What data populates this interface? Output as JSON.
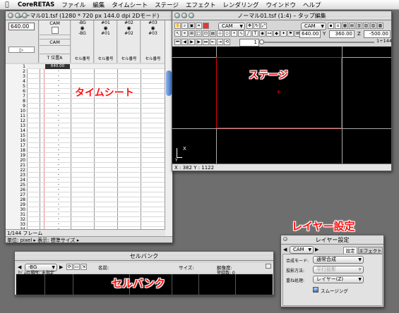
{
  "menubar": {
    "app_name": "CoreRETAS",
    "items": [
      "ファイル",
      "編集",
      "タイムシート",
      "ステージ",
      "エフェクト",
      "レンダリング",
      "ウインドウ",
      "ヘルプ"
    ]
  },
  "timesheet": {
    "title": "ノーマル01.tsf (1280 * 720 px 144.0 dpi 2Dモード)",
    "cam_value": "640.00",
    "cam_header": "CAM",
    "col_cam_label": "CAM",
    "col_tilabel": "T 位置A",
    "layer_cols": [
      {
        "name": "-BG",
        "field": "セル番号"
      },
      {
        "name": "#01",
        "field": "セル番号"
      },
      {
        "name": "#02",
        "field": "セル番号"
      },
      {
        "name": "#03",
        "field": "セル番号"
      }
    ],
    "first_row_value": "640.00",
    "frame_numbers": [
      "1",
      "2",
      "3",
      "4",
      "5",
      "6",
      "7",
      "8",
      "9",
      "10",
      "11",
      "12",
      "13",
      "14",
      "15",
      "16",
      "17",
      "18",
      "19",
      "20",
      "21",
      "22",
      "23",
      "24",
      "25",
      "26",
      "27",
      "28",
      "29",
      "30",
      "31",
      "32",
      "33",
      "34"
    ],
    "frame_count": "1/144 フレーム",
    "footer": "単位: pixel ▸  表示: 標準サイズ ▸"
  },
  "tapedit": {
    "title": "ノーマル01.tsf (1:4) – タップ編集",
    "cam_select": "CAM",
    "cam_select2": "CAM",
    "x_value": "640.00",
    "y_value": "360.00",
    "z_value": "-500.00",
    "y_label": "Y",
    "z_label": "Z",
    "frame_field": "1",
    "frame_total": "1÷144",
    "coords": "X : 382   Y : 1122",
    "axis_x": "X",
    "axis_y": "Y"
  },
  "cellbank": {
    "title": "セルバンク",
    "layer_select": "-BG",
    "col_name": "名前:",
    "col_size": "サイズ:",
    "col_res": "解像度:",
    "status": "ｱﾊﾞﾑの場所: 未指定",
    "count": "登録数: 0"
  },
  "layerset": {
    "title": "レイヤー設定",
    "cam_select": "CAM",
    "tab_settings": "設定",
    "tab_effect": "エフェクト",
    "rows": [
      {
        "label": "合成モード:",
        "value": "通常合成"
      },
      {
        "label": "投影方法:",
        "value": "平行投影"
      },
      {
        "label": "重ね処理:",
        "value": "レイヤー(Z)"
      }
    ],
    "smoothing": "スムージング"
  },
  "annotations": {
    "timesheet": "タイムシート",
    "stage": "ステージ",
    "cellbank": "セルバンク",
    "layerset": "レイヤー設定"
  },
  "colors": {
    "annotation": "#ff1010",
    "stage_frame": "#e00000",
    "stage_bg": "#000000",
    "desktop": "#6e6e6e"
  }
}
